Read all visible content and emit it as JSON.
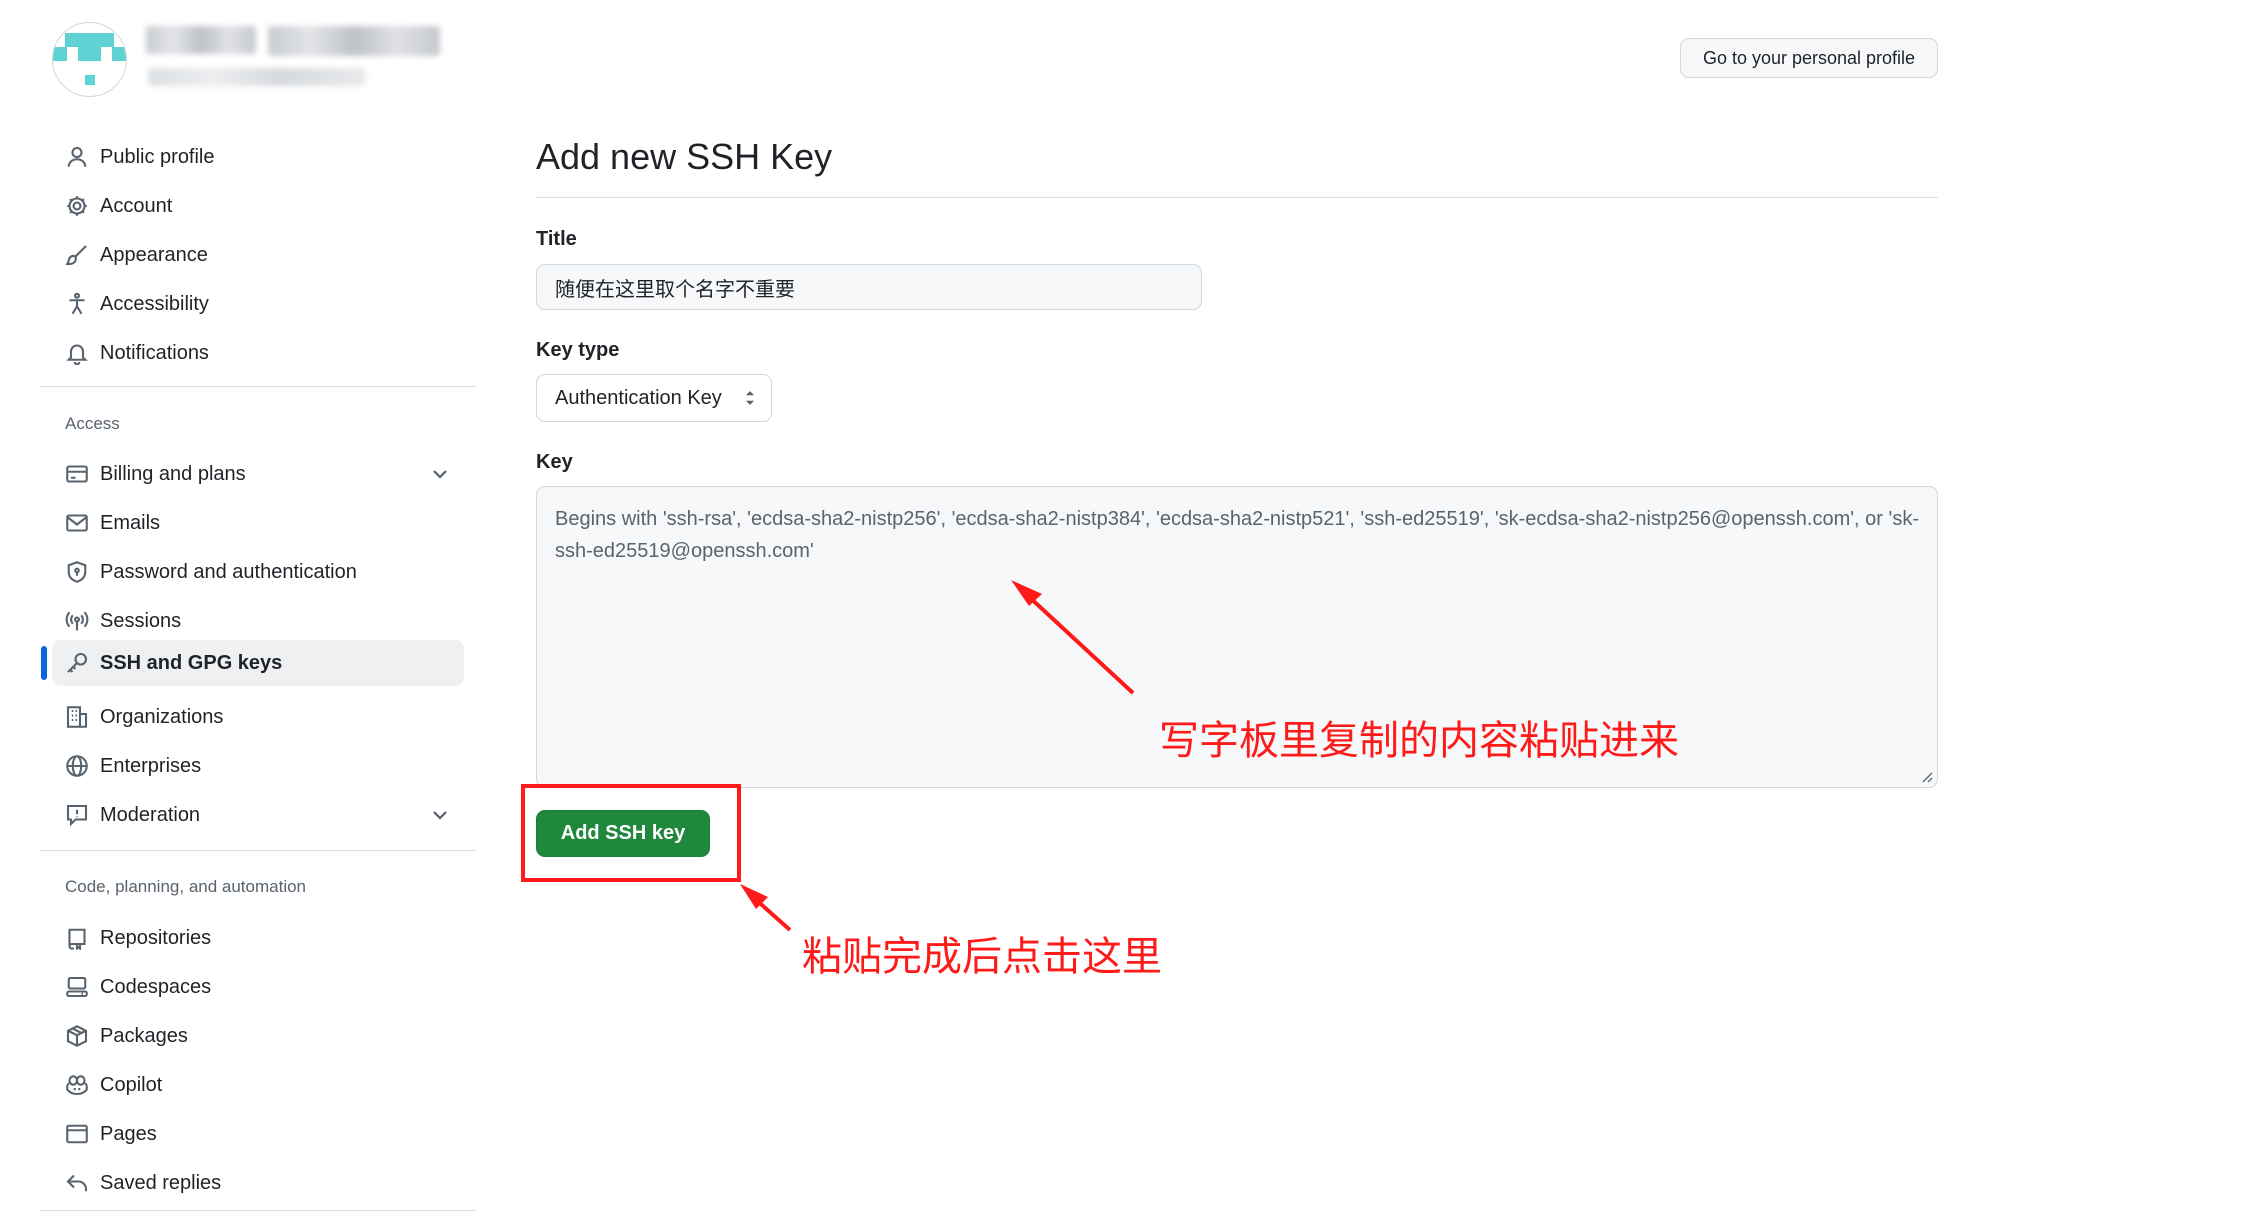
{
  "header": {
    "profile_button": "Go to your personal profile"
  },
  "sidebar": {
    "group_top": [
      {
        "label": "Public profile",
        "icon": "person-icon"
      },
      {
        "label": "Account",
        "icon": "gear-icon"
      },
      {
        "label": "Appearance",
        "icon": "paintbrush-icon"
      },
      {
        "label": "Accessibility",
        "icon": "accessibility-icon"
      },
      {
        "label": "Notifications",
        "icon": "bell-icon"
      }
    ],
    "access_label": "Access",
    "group_access": [
      {
        "label": "Billing and plans",
        "icon": "credit-card-icon",
        "expandable": true
      },
      {
        "label": "Emails",
        "icon": "mail-icon"
      },
      {
        "label": "Password and authentication",
        "icon": "shield-lock-icon"
      },
      {
        "label": "Sessions",
        "icon": "broadcast-icon"
      },
      {
        "label": "SSH and GPG keys",
        "icon": "key-icon",
        "active": true
      },
      {
        "label": "Organizations",
        "icon": "organization-icon"
      },
      {
        "label": "Enterprises",
        "icon": "globe-icon"
      },
      {
        "label": "Moderation",
        "icon": "report-icon",
        "expandable": true
      }
    ],
    "code_label": "Code, planning, and automation",
    "group_code": [
      {
        "label": "Repositories",
        "icon": "repo-icon"
      },
      {
        "label": "Codespaces",
        "icon": "codespaces-icon"
      },
      {
        "label": "Packages",
        "icon": "package-icon"
      },
      {
        "label": "Copilot",
        "icon": "copilot-icon"
      },
      {
        "label": "Pages",
        "icon": "browser-icon"
      },
      {
        "label": "Saved replies",
        "icon": "reply-icon"
      }
    ]
  },
  "main": {
    "page_title": "Add new SSH Key",
    "title_label": "Title",
    "title_value": "随便在这里取个名字不重要",
    "key_type_label": "Key type",
    "key_type_value": "Authentication Key",
    "key_label": "Key",
    "key_placeholder": "Begins with 'ssh-rsa', 'ecdsa-sha2-nistp256', 'ecdsa-sha2-nistp384', 'ecdsa-sha2-nistp521', 'ssh-ed25519', 'sk-ecdsa-sha2-nistp256@openssh.com', or 'sk-ssh-ed25519@openssh.com'",
    "submit_button": "Add SSH key"
  },
  "annotations": {
    "paste_hint": "写字板里复制的内容粘贴进来",
    "click_hint": "粘贴完成后点击这里",
    "color": "#ff1a1a"
  },
  "colors": {
    "accent": "#0969da",
    "primary_button": "#1f883d",
    "avatar": "#5fd3d3"
  }
}
